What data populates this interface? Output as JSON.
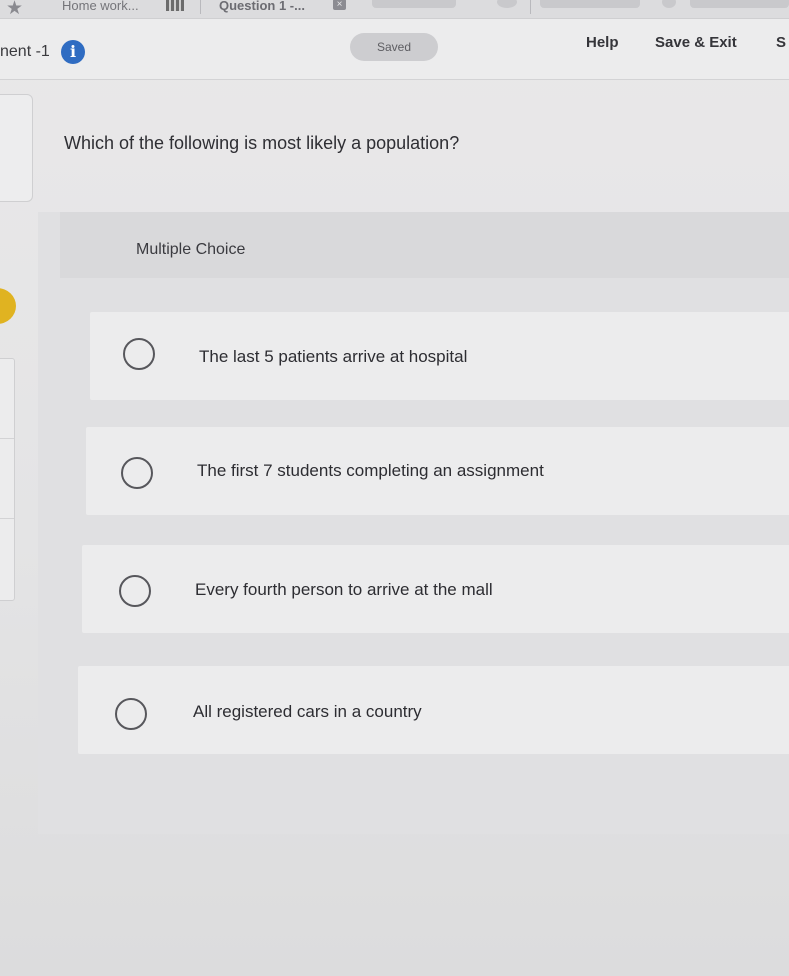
{
  "browser_tabs": {
    "home_tab_label": "Home work...",
    "question_tab_label": "Question 1 -...",
    "close_glyph": "×"
  },
  "header": {
    "assignment_label": "nent -1",
    "info_glyph": "i",
    "saved_label": "Saved",
    "help_label": "Help",
    "save_exit_label": "Save & Exit",
    "submit_label_partial": "S"
  },
  "question": {
    "text": "Which of the following is most likely a population?",
    "type_label": "Multiple Choice",
    "options": [
      {
        "label": "The last 5 patients arrive at hospital",
        "selected": false
      },
      {
        "label": "The first 7 students completing an assignment",
        "selected": false
      },
      {
        "label": "Every fourth person to arrive at the mall",
        "selected": false
      },
      {
        "label": "All registered cars in a country",
        "selected": false
      }
    ]
  },
  "colors": {
    "info_blue": "#2f6cc2",
    "badge_yellow": "#e0b321",
    "saved_pill": "#cdcdd0"
  }
}
